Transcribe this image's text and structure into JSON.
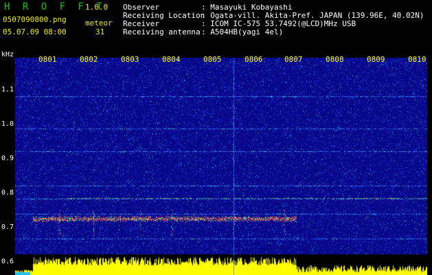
{
  "app": {
    "name_letters": "HROFFT",
    "version": "1.0.0"
  },
  "file": {
    "filename": "0507090800.png",
    "datetime": "05.07.09 08:00"
  },
  "counter": {
    "label": "meteor",
    "value": "31"
  },
  "info": {
    "observer_label": "Observer",
    "observer_value": ": Masayuki Kobayashi",
    "location_label": "Receiving Location",
    "location_value": ": Ogata-vill. Akita-Pref. JAPAN (139.96E, 40.02N)",
    "receiver_label": "Receiver",
    "receiver_value": ": ICOM IC-575 53.7492(@LCD)MHz USB",
    "antenna_label": "Receiving antenna",
    "antenna_value": ": A504HB(yagi 4el)"
  },
  "axis": {
    "unit": "kHz",
    "y_ticks": [
      "1.1",
      "1.0",
      "0.9",
      "0.8",
      "0.7",
      "0.6"
    ],
    "minute_marks": [
      "0801",
      "0802",
      "0803",
      "0804",
      "0805",
      "0806",
      "0807",
      "0808",
      "0809",
      "0810"
    ]
  },
  "colors": {
    "background": "#000000",
    "spectrum_base": "#0a0a8a",
    "signal": "#ff2040",
    "meter": "#ffff00",
    "title": "#19c219"
  }
}
